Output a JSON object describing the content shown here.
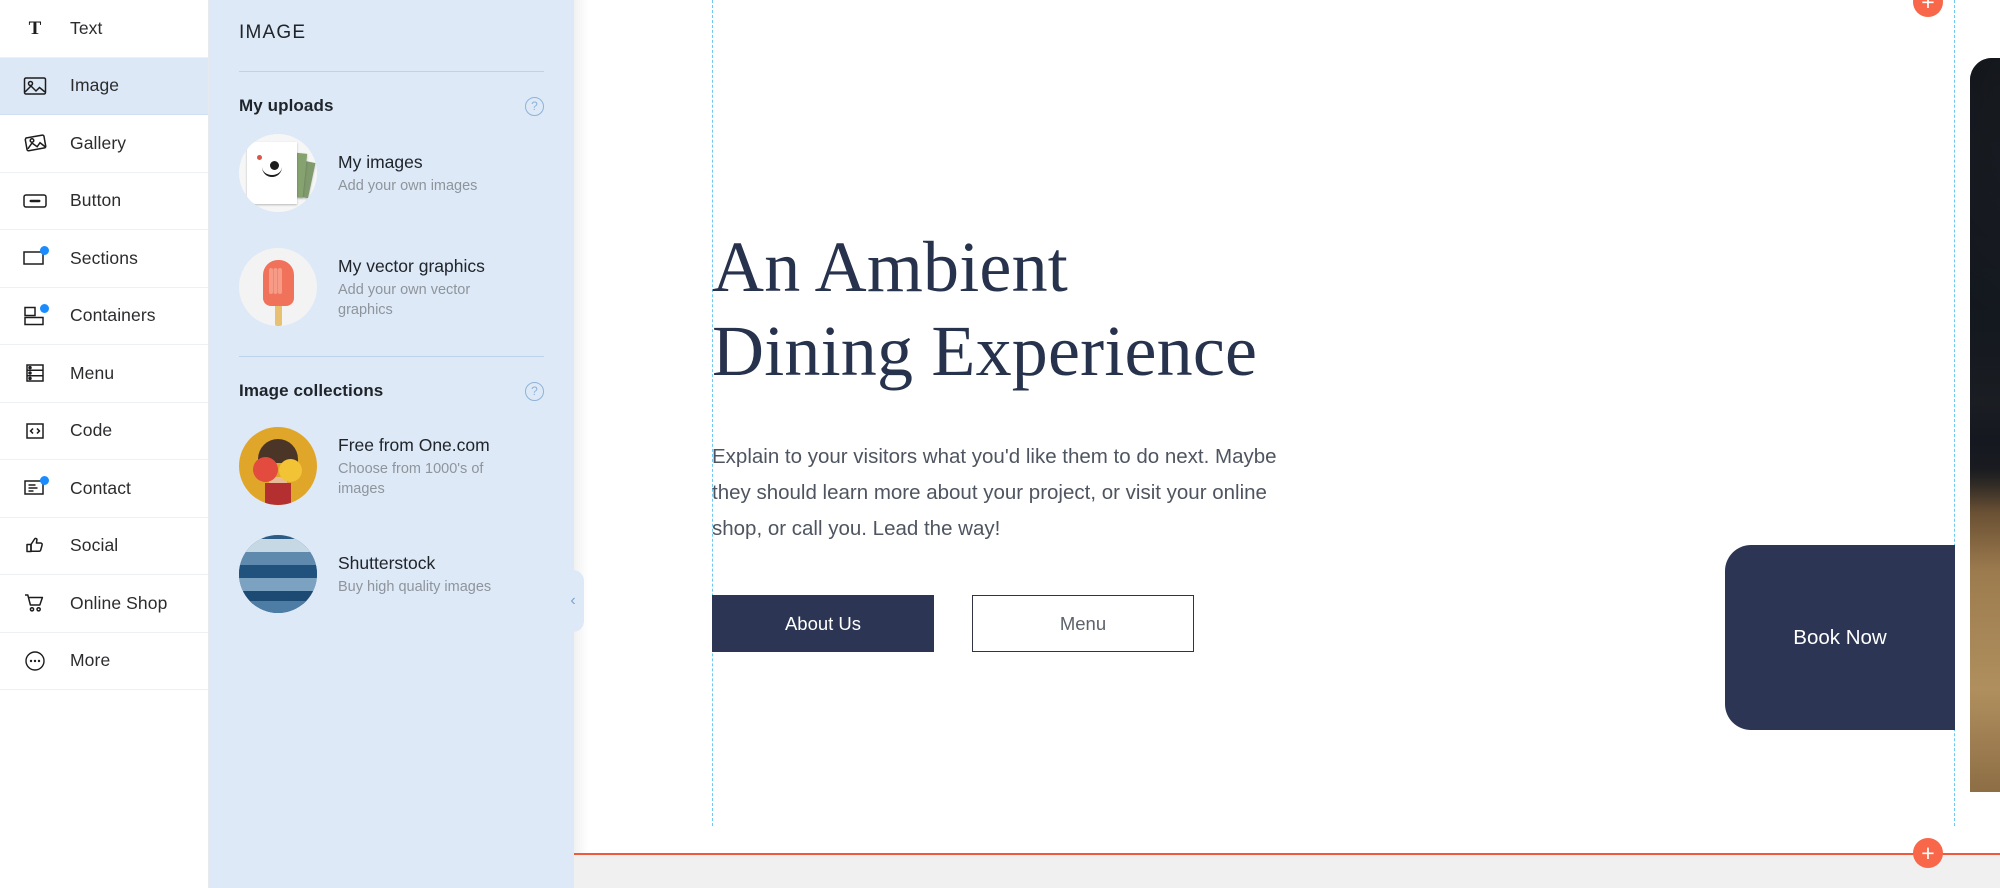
{
  "rail": {
    "items": [
      {
        "label": "Text",
        "icon": "text-icon",
        "badge": false,
        "active": false
      },
      {
        "label": "Image",
        "icon": "image-icon",
        "badge": false,
        "active": true
      },
      {
        "label": "Gallery",
        "icon": "gallery-icon",
        "badge": false,
        "active": false
      },
      {
        "label": "Button",
        "icon": "button-icon",
        "badge": false,
        "active": false
      },
      {
        "label": "Sections",
        "icon": "sections-icon",
        "badge": true,
        "active": false
      },
      {
        "label": "Containers",
        "icon": "containers-icon",
        "badge": true,
        "active": false
      },
      {
        "label": "Menu",
        "icon": "menu-icon",
        "badge": false,
        "active": false
      },
      {
        "label": "Code",
        "icon": "code-icon",
        "badge": false,
        "active": false
      },
      {
        "label": "Contact",
        "icon": "contact-icon",
        "badge": true,
        "active": false
      },
      {
        "label": "Social",
        "icon": "thumbs-up-icon",
        "badge": false,
        "active": false
      },
      {
        "label": "Online Shop",
        "icon": "shopping-cart-icon",
        "badge": false,
        "active": false
      },
      {
        "label": "More",
        "icon": "more-ellipsis-icon",
        "badge": false,
        "active": false
      }
    ]
  },
  "panel": {
    "title": "IMAGE",
    "sections": [
      {
        "heading": "My uploads",
        "help": "?",
        "items": [
          {
            "title": "My images",
            "sub": "Add your own images",
            "thumb": "photos-stack-thumb"
          },
          {
            "title": "My vector graphics",
            "sub": "Add your own vector graphics",
            "thumb": "popsicle-thumb"
          }
        ]
      },
      {
        "heading": "Image collections",
        "help": "?",
        "items": [
          {
            "title": "Free from One.com",
            "sub": "Choose from 1000's of images",
            "thumb": "woman-citrus-thumb"
          },
          {
            "title": "Shutterstock",
            "sub": "Buy high quality images",
            "thumb": "ocean-waves-thumb"
          }
        ]
      }
    ],
    "collapse_icon": "‹"
  },
  "canvas": {
    "hero": {
      "title_line1": "An Ambient",
      "title_line2": "Dining Experience",
      "paragraph": "Explain to your visitors what you'd like them to do next. Maybe they should learn more about your project, or visit your online shop, or call you. Lead the way!",
      "primary_button": "About Us",
      "secondary_button": "Menu"
    },
    "book_now": "Book Now",
    "add_section_top": "+",
    "add_section_bottom": "+",
    "image_alt": "hands-kneading-dough-photo"
  },
  "colors": {
    "panel_bg": "#dde9f7",
    "rail_active": "#dce8f6",
    "brand_navy": "#2c3553",
    "accent_orange": "#f8674a",
    "badge_blue": "#1a8cff",
    "guide_cyan": "#6ec8ef",
    "section_divider": "#ef5a3c"
  }
}
